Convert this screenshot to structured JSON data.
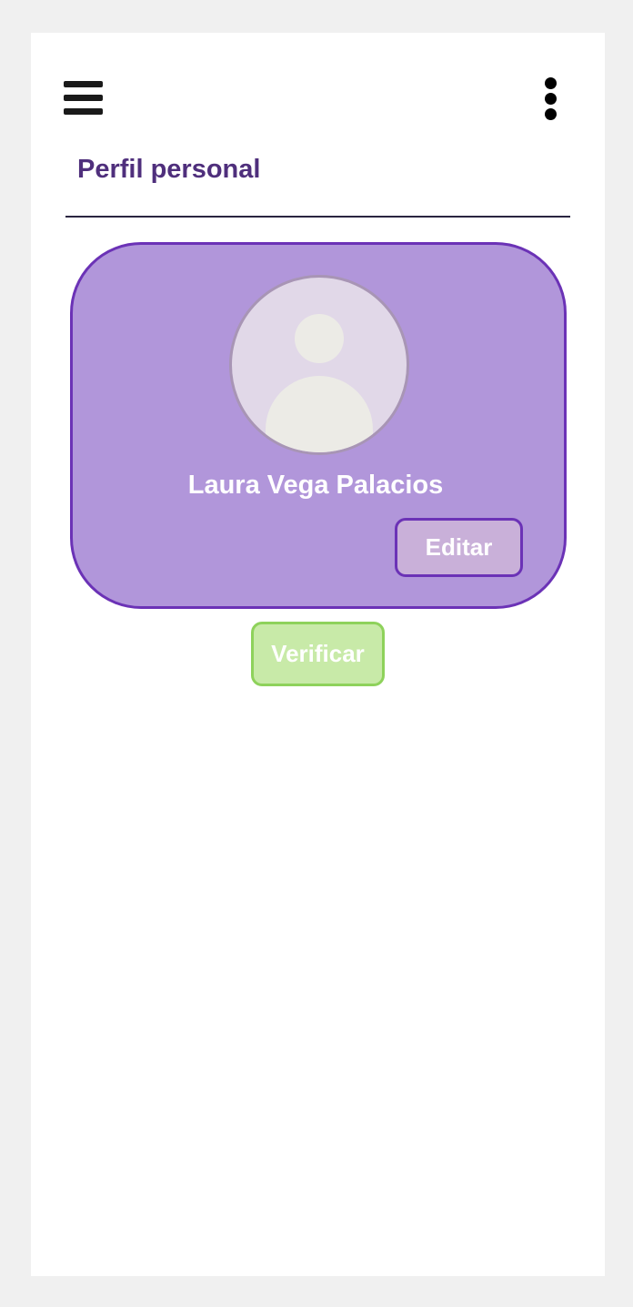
{
  "header": {
    "title": "Perfil personal",
    "menu_icon": "hamburger-menu-icon",
    "more_icon": "more-vertical-icon"
  },
  "profile": {
    "avatar_icon": "user-placeholder-icon",
    "name": "Laura Vega Palacios",
    "edit_label": "Editar"
  },
  "actions": {
    "verify_label": "Verificar"
  },
  "colors": {
    "title": "#4f2f7c",
    "card_fill": "#b196da",
    "card_border": "#6b32b6",
    "edit_fill": "#c9b0d9",
    "verify_fill": "#c8eaa8",
    "verify_border": "#8ed25b"
  }
}
